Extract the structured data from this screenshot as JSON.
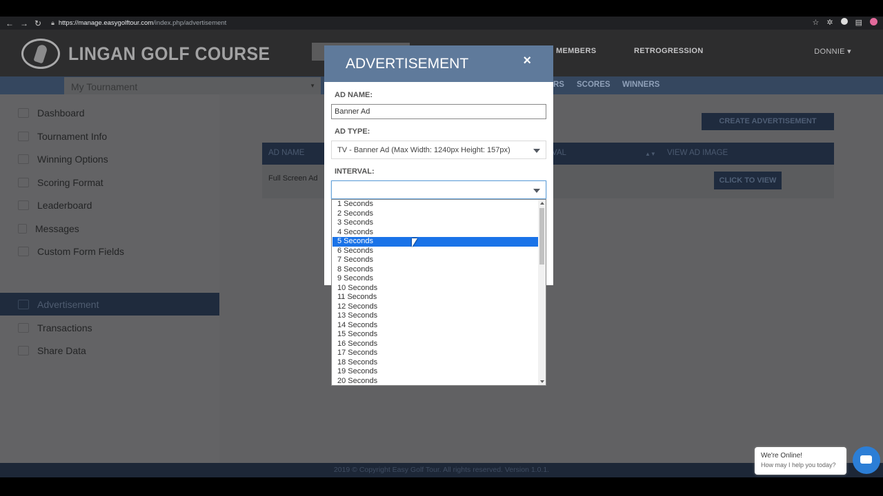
{
  "browser": {
    "url_host": "https://manage.easygolftour.com",
    "url_path": "/index.php/advertisement"
  },
  "header": {
    "brand": "LINGAN GOLF COURSE",
    "nav": [
      "MEMBERS",
      "RETROGRESSION"
    ],
    "user": "DONNIE ▾"
  },
  "subbar": {
    "tournament": "My Tournament",
    "tabs": [
      "RS",
      "SCORES",
      "WINNERS"
    ]
  },
  "sidebar": {
    "items": [
      {
        "label": "Dashboard",
        "icon": "dashboard-icon"
      },
      {
        "label": "Tournament Info",
        "icon": "pin-icon"
      },
      {
        "label": "Winning Options",
        "icon": "award-icon"
      },
      {
        "label": "Scoring Format",
        "icon": "table-icon"
      },
      {
        "label": "Leaderboard",
        "icon": "leaderboard-icon"
      },
      {
        "label": "Messages",
        "icon": "bell-icon"
      },
      {
        "label": "Custom Form Fields",
        "icon": "form-icon"
      },
      {
        "label": "Advertisement",
        "icon": "ad-icon"
      },
      {
        "label": "Transactions",
        "icon": "dollar-icon"
      },
      {
        "label": "Share Data",
        "icon": "pie-icon"
      }
    ],
    "active_index": 7
  },
  "content": {
    "create_button": "CREATE ADVERTISEMENT",
    "columns": [
      "AD NAME",
      "VAL",
      "VIEW AD IMAGE"
    ],
    "rows": [
      {
        "ad_name": "Full Screen Ad",
        "action": "CLICK TO VIEW"
      }
    ]
  },
  "modal": {
    "title": "ADVERTISEMENT",
    "close": "×",
    "ad_name_label": "AD NAME:",
    "ad_name_value": "Banner Ad",
    "ad_type_label": "AD TYPE:",
    "ad_type_value": "TV - Banner Ad (Max Width: 1240px Height: 157px)",
    "interval_label": "INTERVAL:",
    "interval_value": ""
  },
  "dropdown": {
    "options": [
      "1 Seconds",
      "2 Seconds",
      "3 Seconds",
      "4 Seconds",
      "5 Seconds",
      "6 Seconds",
      "7 Seconds",
      "8 Seconds",
      "9 Seconds",
      "10 Seconds",
      "11 Seconds",
      "12 Seconds",
      "13 Seconds",
      "14 Seconds",
      "15 Seconds",
      "16 Seconds",
      "17 Seconds",
      "18 Seconds",
      "19 Seconds",
      "20 Seconds"
    ],
    "highlighted_index": 4
  },
  "footer": "2019 © Copyright Easy Golf Tour. All rights reserved. Version 1.0.1.",
  "chat": {
    "title": "We're Online!",
    "subtitle": "How may I help you today?"
  },
  "colors": {
    "header": "#2d2d2e",
    "subbar": "#35475f",
    "modal_head": "#5f7a9b",
    "highlight": "#1a73e8"
  }
}
